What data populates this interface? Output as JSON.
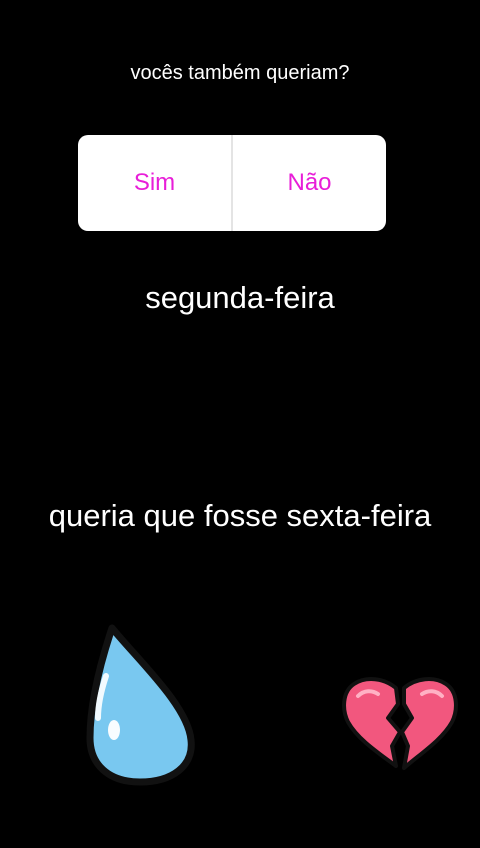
{
  "poll": {
    "question": "vocês também queriam?",
    "options": [
      {
        "label": "Sim"
      },
      {
        "label": "Não"
      }
    ],
    "option_color": "#e81ed8"
  },
  "story_text": {
    "line_1": "segunda-feira",
    "line_2": "queria que fosse sexta-feira"
  },
  "stickers": {
    "left": {
      "icon": "water-drop-icon",
      "color": "#79c8f0"
    },
    "right": {
      "icon": "broken-heart-icon",
      "color": "#f2577e"
    }
  }
}
